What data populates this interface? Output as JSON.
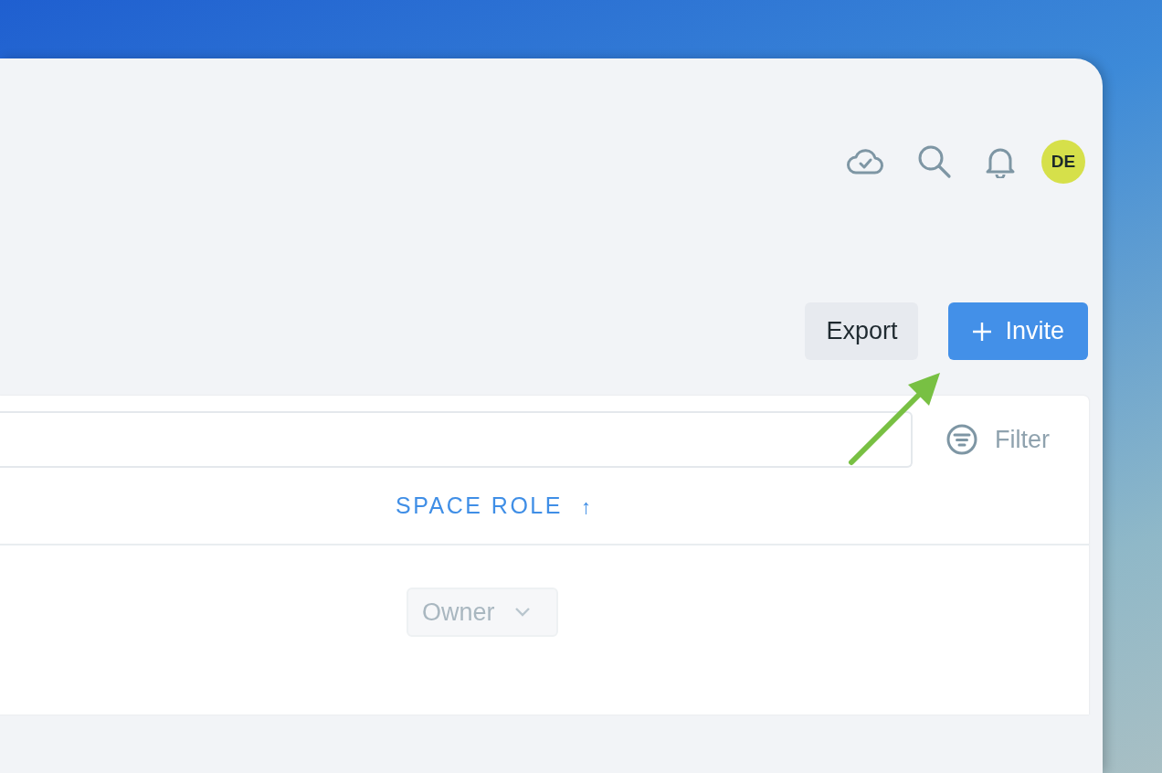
{
  "toolbar": {
    "avatar": {
      "initials": "DE"
    }
  },
  "actions": [
    {
      "label": "Export",
      "kind": "secondary"
    },
    {
      "label": "Invite",
      "kind": "primary"
    }
  ],
  "filter": {
    "label": "Filter"
  },
  "table": {
    "columns": [
      {
        "label": "SPACE ROLE",
        "sort_indicator": "↑"
      }
    ],
    "rows": [
      {
        "role": "Owner",
        "disabled": true
      }
    ]
  }
}
